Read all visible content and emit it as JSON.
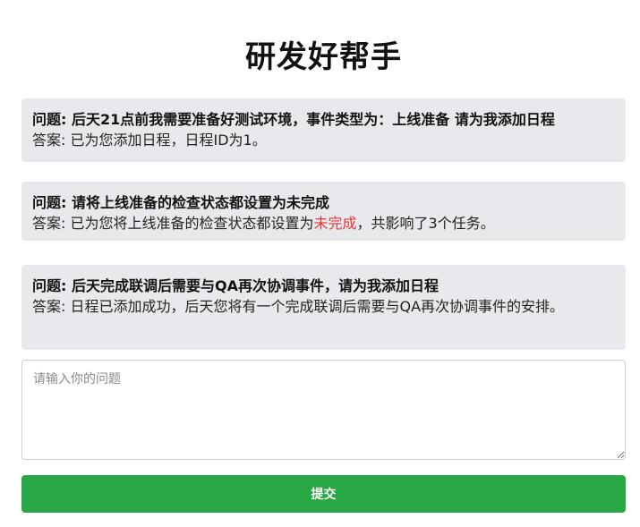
{
  "page": {
    "title": "研发好帮手"
  },
  "qa": [
    {
      "question_prefix": "问题: ",
      "question": "后天21点前我需要准备好测试环境，事件类型为：上线准备 请为我添加日程",
      "answer_prefix": "答案: ",
      "answer_before": "已为您添加日程，日程ID为1。",
      "answer_highlight": "",
      "answer_after": ""
    },
    {
      "question_prefix": "问题: ",
      "question": "请将上线准备的检查状态都设置为未完成",
      "answer_prefix": "答案: ",
      "answer_before": "已为您将上线准备的检查状态都设置为",
      "answer_highlight": "未完成",
      "answer_after": "，共影响了3个任务。"
    },
    {
      "question_prefix": "问题: ",
      "question": "后天完成联调后需要与QA再次协调事件，请为我添加日程",
      "answer_prefix": "答案: ",
      "answer_before": "日程已添加成功，后天您将有一个完成联调后需要与QA再次协调事件的安排。",
      "answer_highlight": "",
      "answer_after": ""
    }
  ],
  "input": {
    "placeholder": "请输入你的问题",
    "value": ""
  },
  "submit": {
    "label": "提交"
  },
  "colors": {
    "card_bg": "#e7e9ec",
    "submit_bg": "#28a745",
    "highlight": "#e53935"
  }
}
